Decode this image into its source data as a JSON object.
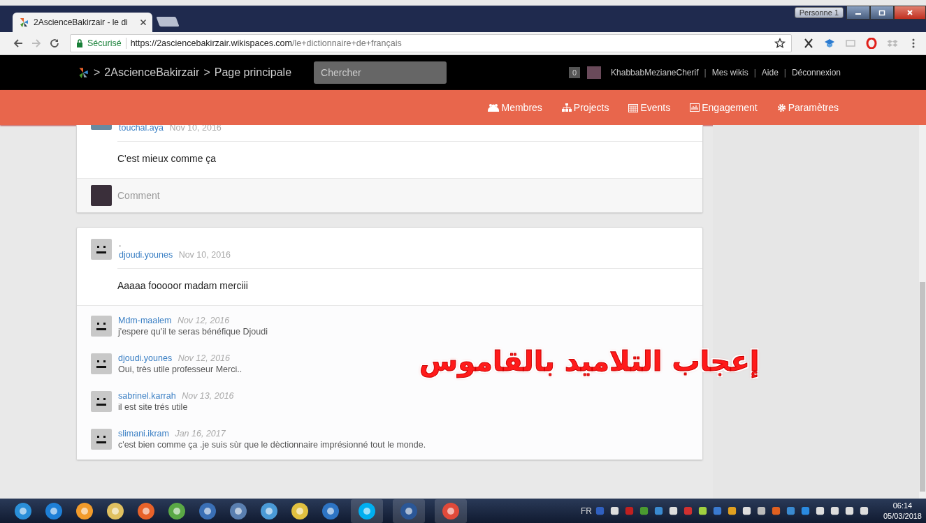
{
  "browser": {
    "tab_title": "2AscienceBakirzair - le di",
    "profile": "Personne 1",
    "secure_label": "Sécurisé",
    "url_host": "https://2asciencebakirzair.wikispaces.com",
    "url_path": "/le+dictionnaire+de+français"
  },
  "wiki_header": {
    "separator": ">",
    "breadcrumb": [
      "2AscienceBakirzair",
      "Page principale"
    ],
    "search": {
      "placeholder": "Chercher"
    },
    "notifications": "0",
    "user": "KhabbabMezianeCherif",
    "link_separator": "|",
    "links": [
      "Mes wikis",
      "Aide",
      "Déconnexion"
    ]
  },
  "nav": [
    "Membres",
    "Projects",
    "Events",
    "Engagement",
    "Paramètres"
  ],
  "posts": [
    {
      "author": "touchal.aya",
      "date": "Nov 10, 2016",
      "body": "C'est mieux comme ça",
      "comment_placeholder": "Comment"
    },
    {
      "title": ".",
      "author": "djoudi.younes",
      "date": "Nov 10, 2016",
      "body": "Aaaaa fooooor madam merciii",
      "replies": [
        {
          "author": "Mdm-maalem",
          "date": "Nov 12, 2016",
          "text": "j'espere qu'il te seras bénéfique Djoudi"
        },
        {
          "author": "djoudi.younes",
          "date": "Nov 12, 2016",
          "text": "Oui, très utile professeur Merci.."
        },
        {
          "author": "sabrinel.karrah",
          "date": "Nov 13, 2016",
          "text": "il est site trés utile"
        },
        {
          "author": "slimani.ikram",
          "date": "Jan 16, 2017",
          "text": "c'est bien comme ça .je suis sùr que le dèctionnaire imprésionné tout le monde."
        }
      ]
    }
  ],
  "overlay_caption": "إعجاب التلاميد بالقاموس",
  "taskbar": {
    "language": "FR",
    "time": "06:14",
    "date": "05/03/2018"
  }
}
